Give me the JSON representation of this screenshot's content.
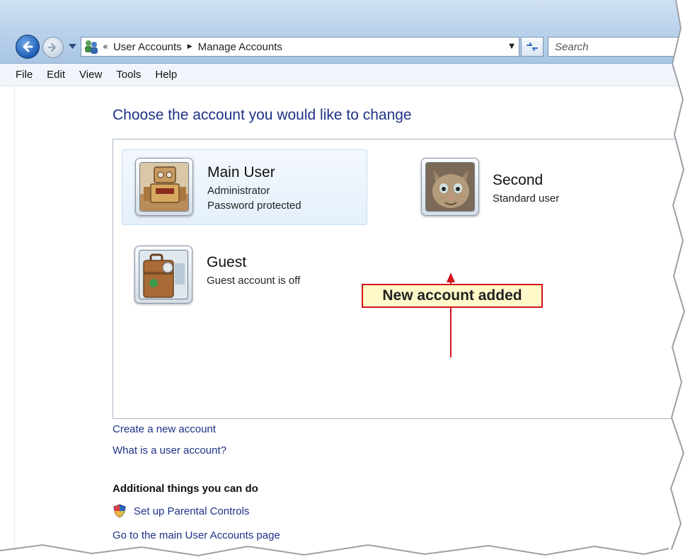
{
  "nav": {
    "breadcrumb_prefix": "«",
    "breadcrumb": [
      "User Accounts",
      "Manage Accounts"
    ],
    "search_placeholder": "Search"
  },
  "menu": [
    "File",
    "Edit",
    "View",
    "Tools",
    "Help"
  ],
  "main": {
    "title": "Choose the account you would like to change",
    "accounts": [
      {
        "name": "Main User",
        "lines": [
          "Administrator",
          "Password protected"
        ],
        "avatar": "robot-avatar",
        "selected": true
      },
      {
        "name": "Second",
        "lines": [
          "Standard user"
        ],
        "avatar": "kitten-avatar",
        "selected": false
      },
      {
        "name": "Guest",
        "lines": [
          "Guest account is off"
        ],
        "avatar": "suitcase-avatar",
        "selected": false
      }
    ],
    "callout": "New account added",
    "links": {
      "create": "Create a new account",
      "what_is": "What is a user account?"
    },
    "additional": {
      "title": "Additional things you can do",
      "parental": "Set up Parental Controls",
      "main_page": "Go to the main User Accounts page"
    }
  },
  "colors": {
    "link": "#1e3287",
    "callout_border": "#d4131d",
    "callout_fill": "#fff8c8",
    "selected_tile": "#e5f0fb"
  }
}
